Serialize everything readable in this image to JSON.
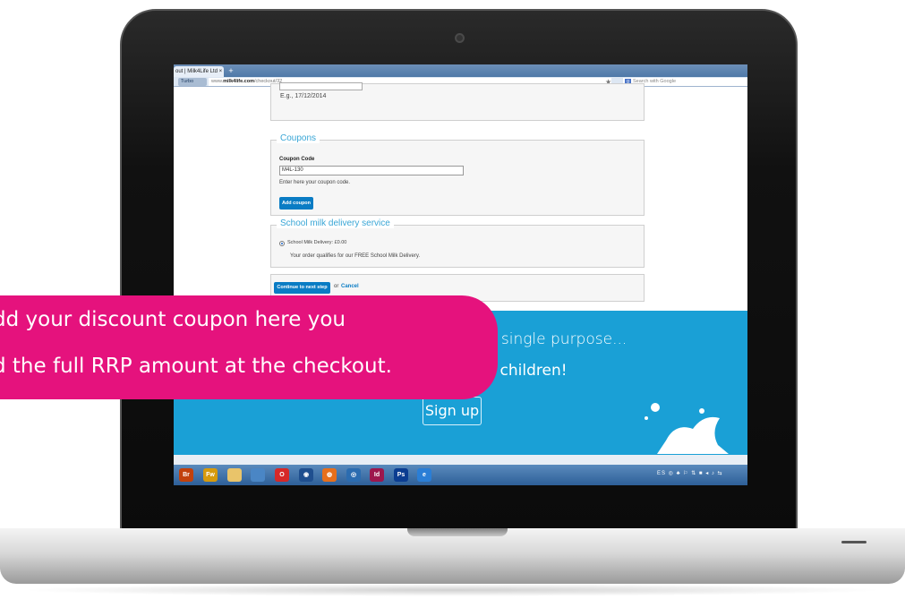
{
  "browser": {
    "tab_title": "out | Milk4Life Ltd ×",
    "new_tab": "+",
    "turbo_label": "Turbo",
    "url_prefix": "www.",
    "url_domain": "milk4life.com",
    "url_path": "/checkout/32",
    "search_placeholder": "Search with Google"
  },
  "checkout": {
    "date_hint": "E.g., 17/12/2014",
    "coupons": {
      "legend": "Coupons",
      "label": "Coupon Code",
      "value": "M4L-130",
      "help": "Enter here your coupon code.",
      "button": "Add coupon"
    },
    "delivery": {
      "legend": "School milk delivery service",
      "option": "School Milk Delivery: £0.00",
      "note": "Your order qualifies for our FREE School Milk Delivery."
    },
    "actions": {
      "continue": "Continue to next step",
      "or": "or",
      "cancel": "Cancel"
    }
  },
  "promo": {
    "line1": "e single purpose...",
    "line2": "ol children!",
    "signup": "Sign up"
  },
  "taskbar": {
    "apps": [
      "Br",
      "Fw",
      "",
      "",
      "",
      "",
      "",
      "",
      "Id",
      "Ps",
      "e"
    ],
    "tray": "ES ◎ ♣ ⚐ ⇅ ■ ◂ ♪ ⇆"
  },
  "callout": {
    "line1": "dd your discount coupon here you",
    "line2": "d the full RRP amount at the checkout."
  },
  "colors": {
    "accent_blue": "#1aa0d6",
    "button_blue": "#0a7cc4",
    "callout_pink": "#e5127d"
  }
}
